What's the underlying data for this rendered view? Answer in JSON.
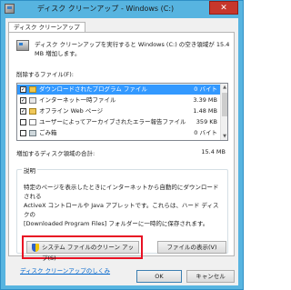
{
  "window": {
    "title": "ディスク クリーンアップ - Windows (C:)",
    "close_label": "✕"
  },
  "tab": {
    "label": "ディスク クリーンアップ"
  },
  "intro": {
    "text_line1": "ディスク クリーンアップを実行すると Windows (C:) の空き領域が 15.4",
    "text_line2": "MB 増加します。"
  },
  "files_section": {
    "label": "削除するファイル(F):",
    "rows": [
      {
        "name": "ダウンロードされたプログラム ファイル",
        "size": "0 バイト",
        "checked": true,
        "selected": true,
        "icon": "folder-icon"
      },
      {
        "name": "インターネット一時ファイル",
        "size": "3.39 MB",
        "checked": true,
        "selected": false,
        "icon": "internet-files-icon"
      },
      {
        "name": "オフライン Web ページ",
        "size": "1.48 MB",
        "checked": true,
        "selected": false,
        "icon": "offline-pages-icon"
      },
      {
        "name": "ユーザーによってアーカイブされたエラー報告ファイル",
        "size": "359 KB",
        "checked": false,
        "selected": false,
        "icon": "report-files-icon"
      },
      {
        "name": "ごみ箱",
        "size": "0 バイト",
        "checked": false,
        "selected": false,
        "icon": "recycle-bin-icon"
      }
    ]
  },
  "total": {
    "label": "増加するディスク領域の合計:",
    "value": "15.4 MB"
  },
  "description": {
    "group_label": "説明",
    "line1": "特定のページを表示したときにインターネットから自動的にダウンロードされる",
    "line2": "ActiveX コントロールや Java アプレットです。これらは、ハード ディスクの",
    "line3": "[Downloaded Program Files] フォルダーに一時的に保存されます。"
  },
  "buttons": {
    "clean_system": "システム ファイルのクリーン アップ(S)",
    "view_files": "ファイルの表示(V)",
    "ok": "OK",
    "cancel": "キャンセル"
  },
  "link": {
    "text": "ディスク クリーンアップのしくみ"
  },
  "colors": {
    "highlight": "#e81123",
    "selection": "#3399ff",
    "link": "#0066cc",
    "title_bar": "#57b4e0"
  }
}
